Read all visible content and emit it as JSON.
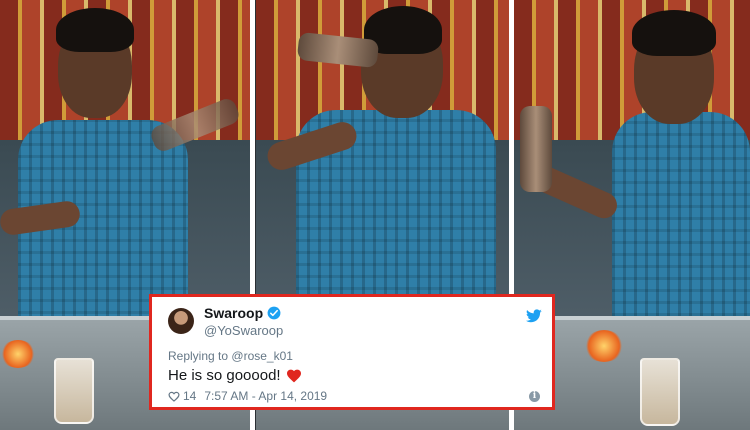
{
  "panels": [
    {
      "name": "panel-left"
    },
    {
      "name": "panel-middle"
    },
    {
      "name": "panel-right"
    }
  ],
  "tweet": {
    "display_name": "Swaroop",
    "handle": "@YoSwaroop",
    "replying_to_prefix": "Replying to",
    "replying_to_handle": "@rose_k01",
    "text": "He is so gooood!",
    "like_count": "14",
    "timestamp": "7:57 AM - Apr 14, 2019",
    "icons": {
      "verified": "verified-badge-icon",
      "platform": "twitter-bird-icon",
      "emoji": "red-heart-icon",
      "like": "heart-outline-icon",
      "info": "info-icon"
    },
    "colors": {
      "border": "#e0271f",
      "brand": "#1da1f2",
      "text": "#14171a",
      "muted": "#657786",
      "heart": "#e0245e"
    }
  }
}
